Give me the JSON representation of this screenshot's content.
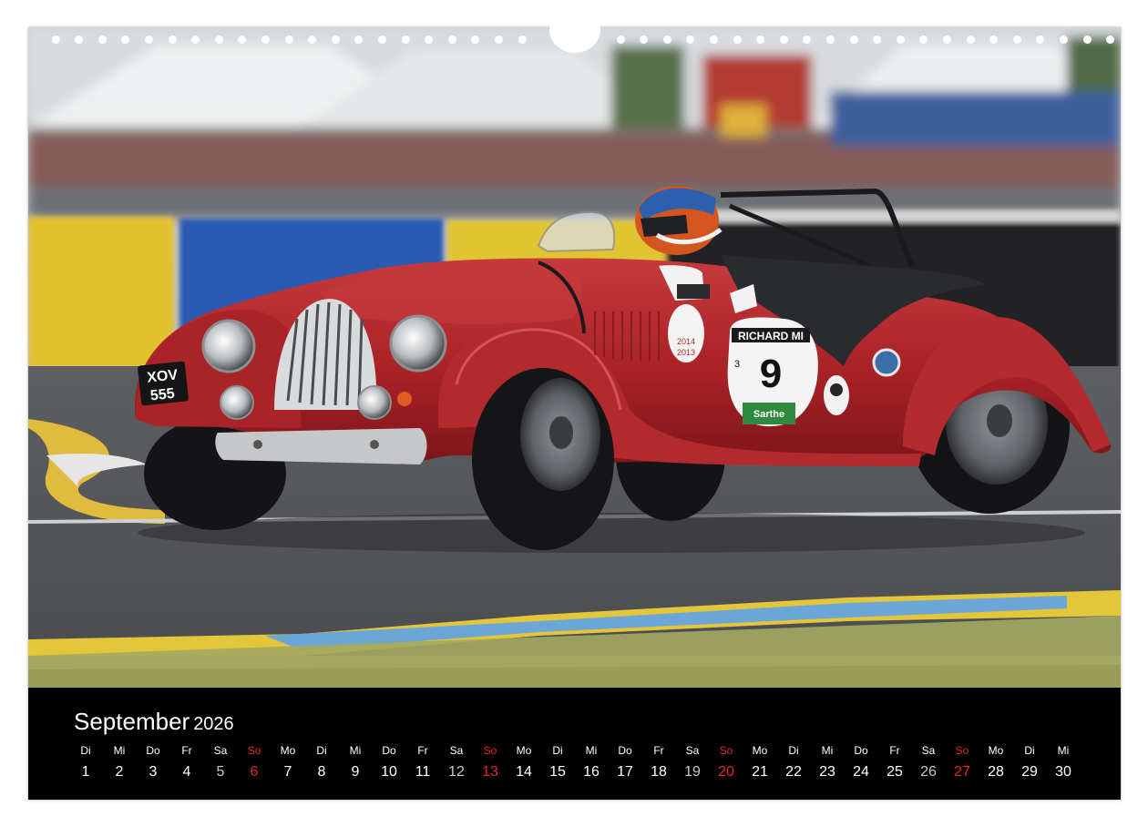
{
  "calendar": {
    "month": "September",
    "year": "2026",
    "days": [
      {
        "name": "Di",
        "num": "1"
      },
      {
        "name": "Mi",
        "num": "2"
      },
      {
        "name": "Do",
        "num": "3"
      },
      {
        "name": "Fr",
        "num": "4"
      },
      {
        "name": "Sa",
        "num": "5"
      },
      {
        "name": "So",
        "num": "6"
      },
      {
        "name": "Mo",
        "num": "7"
      },
      {
        "name": "Di",
        "num": "8"
      },
      {
        "name": "Mi",
        "num": "9"
      },
      {
        "name": "Do",
        "num": "10"
      },
      {
        "name": "Fr",
        "num": "11"
      },
      {
        "name": "Sa",
        "num": "12"
      },
      {
        "name": "So",
        "num": "13"
      },
      {
        "name": "Mo",
        "num": "14"
      },
      {
        "name": "Di",
        "num": "15"
      },
      {
        "name": "Mi",
        "num": "16"
      },
      {
        "name": "Do",
        "num": "17"
      },
      {
        "name": "Fr",
        "num": "18"
      },
      {
        "name": "Sa",
        "num": "19"
      },
      {
        "name": "So",
        "num": "20"
      },
      {
        "name": "Mo",
        "num": "21"
      },
      {
        "name": "Di",
        "num": "22"
      },
      {
        "name": "Mi",
        "num": "23"
      },
      {
        "name": "Do",
        "num": "24"
      },
      {
        "name": "Fr",
        "num": "25"
      },
      {
        "name": "Sa",
        "num": "26"
      },
      {
        "name": "So",
        "num": "27"
      },
      {
        "name": "Mo",
        "num": "28"
      },
      {
        "name": "Di",
        "num": "29"
      },
      {
        "name": "Mi",
        "num": "30"
      }
    ],
    "sunday_color": "#e0262c",
    "saturday_color": "#c9c9c9"
  },
  "photo": {
    "subject": "red-vintage-roadster-race-car",
    "number_plate": "XOV 555",
    "race_number": "9",
    "sponsor_text": "RICHARD MI",
    "sticker_years": "2014 2013",
    "sticker_brand": "Sarthe",
    "side_number": "3",
    "body_color": "#b8282c"
  }
}
